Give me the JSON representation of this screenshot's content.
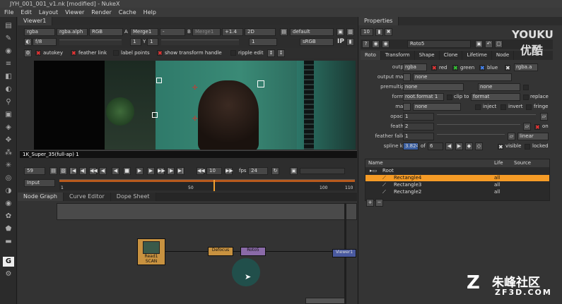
{
  "window": {
    "title": "JYH_001_001_v1.nk [modified] - NukeX"
  },
  "menu": [
    "File",
    "Edit",
    "Layout",
    "Viewer",
    "Render",
    "Cache",
    "Help"
  ],
  "viewer": {
    "tab": "Viewer1",
    "channels": "rgba",
    "channels2": "rgba.alph",
    "colorspace": "RGB",
    "a_label": "A",
    "a_input": "Merge1",
    "a_op": "-",
    "b_label": "B",
    "b_input": "Merge1",
    "zoom": "+1.4",
    "view": "2D",
    "lut": "default",
    "fstop": "f/8",
    "frame_in": "1",
    "y_label": "Y",
    "y_val": "1",
    "gamma": "1",
    "display": "sRGB",
    "ip": "IP",
    "roto_bar": {
      "autokey": "autokey",
      "feather_link": "feather link",
      "label_points": "label points",
      "show_transform": "show transform handle",
      "ripple": "ripple edit"
    },
    "format_label": "1K_Super_35(full-ap) 1",
    "timeline": {
      "frame": "59",
      "step": "10",
      "fps_label": "fps",
      "fps": "24",
      "input": "Input",
      "ticks": [
        "1",
        "50",
        "100",
        "110"
      ],
      "current_frame": 59
    }
  },
  "node_graph": {
    "tabs": [
      "Node Graph",
      "Curve Editor",
      "Dope Sheet"
    ],
    "nodes": [
      {
        "label": "Read1",
        "sub": "SCAN"
      },
      {
        "label": "Defocus",
        "sub": ""
      },
      {
        "label": "Roto5",
        "sub": ""
      },
      {
        "label": "Viewer1",
        "sub": ""
      }
    ]
  },
  "properties": {
    "title": "Properties",
    "count": "10",
    "node_name": "Roto5",
    "tabs": [
      "Roto",
      "Transform",
      "Shape",
      "Clone",
      "Lifetime",
      "Node"
    ],
    "output": {
      "label": "output",
      "value": "rgba",
      "red": "red",
      "green": "green",
      "blue": "blue",
      "alpha": "rgba.a"
    },
    "output_mask": {
      "label": "output mask",
      "value": "none"
    },
    "premultiply": {
      "label": "premultiply",
      "value": "none",
      "value2": "none"
    },
    "format": {
      "label": "format",
      "value": "root.format 1",
      "clip": "clip to",
      "clip_val": "format",
      "replace": "replace"
    },
    "mask": {
      "label": "mask",
      "value": "none",
      "inject": "inject",
      "invert": "invert",
      "fringe": "fringe"
    },
    "opacity": {
      "label": "opacity",
      "value": "1"
    },
    "feather": {
      "label": "feather",
      "value": "2",
      "on": "on"
    },
    "feather_falloff": {
      "label": "feather falloff",
      "value": "1",
      "interp": "linear"
    },
    "spline_key": {
      "label": "spline key",
      "value": "3.824",
      "of": "of",
      "total": "6",
      "visible": "visible",
      "locked": "locked"
    },
    "table": {
      "headers": [
        "Name",
        "Life",
        "Source"
      ],
      "rows": [
        {
          "name": "Root",
          "life": ""
        },
        {
          "name": "Rectangle4",
          "life": "all"
        },
        {
          "name": "Rectangle3",
          "life": "all"
        },
        {
          "name": "Rectangle2",
          "life": "all"
        }
      ]
    }
  },
  "watermark": {
    "youku": "YOUKU",
    "youku_cn": "优酷",
    "site_cn": "朱峰社区",
    "site": "ZF3D.COM"
  },
  "colors": {
    "accent": "#f0a030",
    "selected_row": "#f59b26",
    "roto_color": "#6a4d8c",
    "read_color": "#c89240"
  }
}
